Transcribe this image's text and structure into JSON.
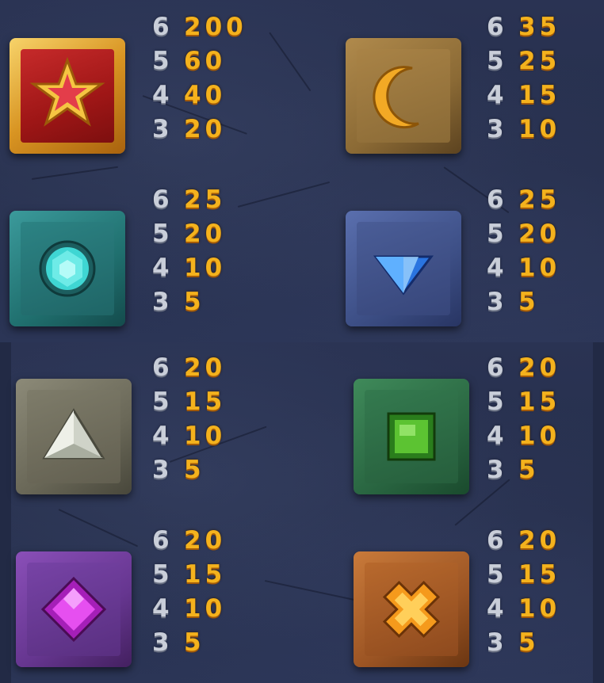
{
  "symbols": [
    {
      "name": "Red Star",
      "payouts": [
        {
          "count": "6",
          "amount": "200"
        },
        {
          "count": "5",
          "amount": "60"
        },
        {
          "count": "4",
          "amount": "40"
        },
        {
          "count": "3",
          "amount": "20"
        }
      ]
    },
    {
      "name": "Moon",
      "payouts": [
        {
          "count": "6",
          "amount": "35"
        },
        {
          "count": "5",
          "amount": "25"
        },
        {
          "count": "4",
          "amount": "15"
        },
        {
          "count": "3",
          "amount": "10"
        }
      ]
    },
    {
      "name": "Cyan Gem",
      "payouts": [
        {
          "count": "6",
          "amount": "25"
        },
        {
          "count": "5",
          "amount": "20"
        },
        {
          "count": "4",
          "amount": "10"
        },
        {
          "count": "3",
          "amount": "5"
        }
      ]
    },
    {
      "name": "Blue Diamond",
      "payouts": [
        {
          "count": "6",
          "amount": "25"
        },
        {
          "count": "5",
          "amount": "20"
        },
        {
          "count": "4",
          "amount": "10"
        },
        {
          "count": "3",
          "amount": "5"
        }
      ]
    },
    {
      "name": "White Triangle",
      "payouts": [
        {
          "count": "6",
          "amount": "20"
        },
        {
          "count": "5",
          "amount": "15"
        },
        {
          "count": "4",
          "amount": "10"
        },
        {
          "count": "3",
          "amount": "5"
        }
      ]
    },
    {
      "name": "Green Square",
      "payouts": [
        {
          "count": "6",
          "amount": "20"
        },
        {
          "count": "5",
          "amount": "15"
        },
        {
          "count": "4",
          "amount": "10"
        },
        {
          "count": "3",
          "amount": "5"
        }
      ]
    },
    {
      "name": "Purple Rhombus",
      "payouts": [
        {
          "count": "6",
          "amount": "20"
        },
        {
          "count": "5",
          "amount": "15"
        },
        {
          "count": "4",
          "amount": "10"
        },
        {
          "count": "3",
          "amount": "5"
        }
      ]
    },
    {
      "name": "Orange Cross",
      "payouts": [
        {
          "count": "6",
          "amount": "20"
        },
        {
          "count": "5",
          "amount": "15"
        },
        {
          "count": "4",
          "amount": "10"
        },
        {
          "count": "3",
          "amount": "5"
        }
      ]
    }
  ],
  "colors": {
    "count_text": "#c9ced9",
    "amount_text": "#f4b21d",
    "background": "#262f4c"
  }
}
